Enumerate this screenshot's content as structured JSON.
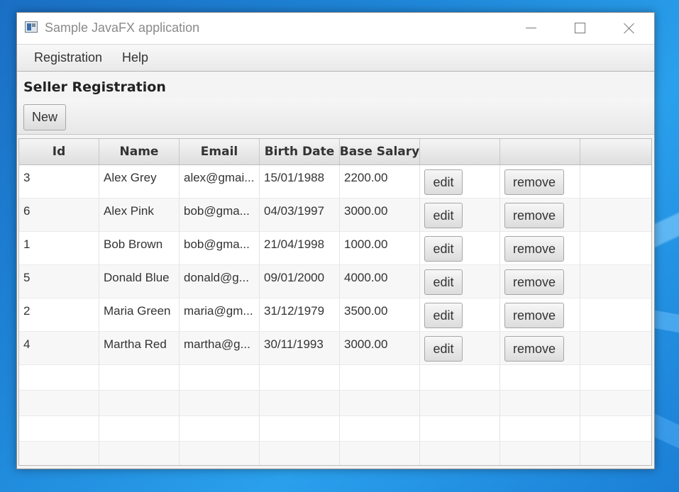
{
  "window": {
    "title": "Sample JavaFX application"
  },
  "menubar": {
    "items": [
      "Registration",
      "Help"
    ]
  },
  "page": {
    "heading": "Seller Registration",
    "new_button": "New"
  },
  "table": {
    "columns": [
      "Id",
      "Name",
      "Email",
      "Birth Date",
      "Base Salary",
      "",
      "",
      ""
    ],
    "edit_label": "edit",
    "remove_label": "remove",
    "rows": [
      {
        "id": "3",
        "name": "Alex Grey",
        "email": "alex@gmai...",
        "birth": "15/01/1988",
        "salary": "2200.00"
      },
      {
        "id": "6",
        "name": "Alex Pink",
        "email": "bob@gma...",
        "birth": "04/03/1997",
        "salary": "3000.00"
      },
      {
        "id": "1",
        "name": "Bob Brown",
        "email": "bob@gma...",
        "birth": "21/04/1998",
        "salary": "1000.00"
      },
      {
        "id": "5",
        "name": "Donald Blue",
        "email": "donald@g...",
        "birth": "09/01/2000",
        "salary": "4000.00"
      },
      {
        "id": "2",
        "name": "Maria Green",
        "email": "maria@gm...",
        "birth": "31/12/1979",
        "salary": "3500.00"
      },
      {
        "id": "4",
        "name": "Martha Red",
        "email": "martha@g...",
        "birth": "30/11/1993",
        "salary": "3000.00"
      }
    ],
    "empty_rows": 4
  }
}
